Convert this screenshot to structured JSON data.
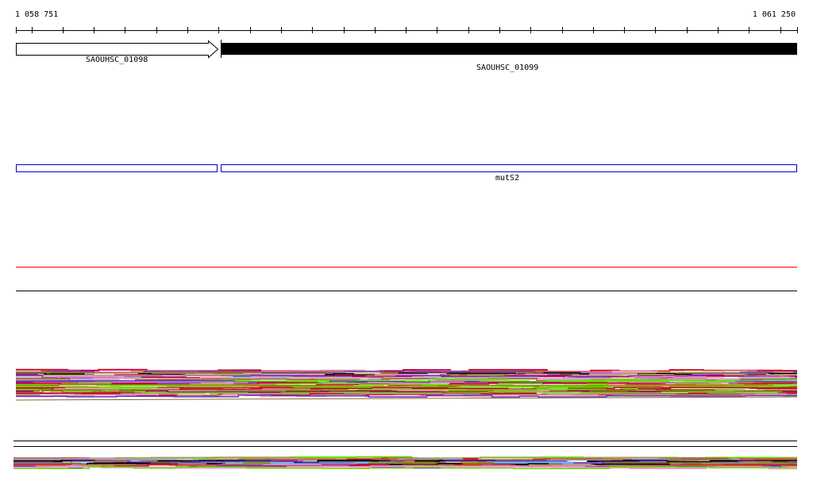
{
  "ruler": {
    "start_label": "1 058 751",
    "end_label": "1 061 250"
  },
  "genes": [
    {
      "name": "SAOUHSC_01098",
      "strand": "+",
      "style": "open-arrow"
    },
    {
      "name": "SAOUHSC_01099",
      "style": "filled"
    }
  ],
  "features": [
    {
      "name": "",
      "color": "#0000cc"
    },
    {
      "name": "mutS2",
      "color": "#0000cc"
    }
  ],
  "track_colors": {
    "red_line": "#ff0000",
    "divider": "#000000"
  },
  "alignment_palette": [
    "#000000",
    "#66dd00",
    "#808000",
    "#aaaacc",
    "#cc6633",
    "#990066",
    "#cc0033",
    "#66bbee",
    "#886622",
    "#aa9966",
    "#ff99cc",
    "#6633cc",
    "#dd88aa"
  ]
}
